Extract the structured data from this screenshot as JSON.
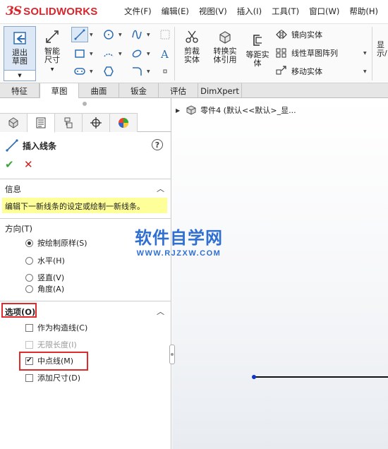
{
  "app": {
    "logo_prefix": "3S",
    "logo_name": "SOLIDWORKS"
  },
  "menubar": [
    {
      "label": "文件(F)"
    },
    {
      "label": "编辑(E)"
    },
    {
      "label": "视图(V)"
    },
    {
      "label": "插入(I)"
    },
    {
      "label": "工具(T)"
    },
    {
      "label": "窗口(W)"
    },
    {
      "label": "帮助(H)"
    }
  ],
  "ribbon": {
    "exit_sketch": "退出草图",
    "smart_dimension": "智能尺寸",
    "trim": "剪裁实体",
    "convert": "转换实体引用",
    "offset": "等距实体",
    "mirror": "镜向实体",
    "linear_pattern": "线性草图阵列",
    "move": "移动实体",
    "display_partial": "显示/"
  },
  "tabs": [
    {
      "label": "特征"
    },
    {
      "label": "草图"
    },
    {
      "label": "曲面"
    },
    {
      "label": "钣金"
    },
    {
      "label": "评估"
    },
    {
      "label": "DimXpert"
    }
  ],
  "property_manager": {
    "title": "插入线条",
    "help_symbol": "?",
    "ok_symbol": "✔",
    "cancel_symbol": "✕",
    "info_header": "信息",
    "info_text": "编辑下一新线条的设定或绘制一新线条。",
    "direction_header": "方向(T)",
    "direction_options": [
      {
        "label": "按绘制原样(S)",
        "selected": true
      },
      {
        "label": "水平(H)",
        "selected": false
      },
      {
        "label": "竖直(V)",
        "selected": false
      },
      {
        "label": "角度(A)",
        "selected": false
      }
    ],
    "options_header": "选项(O)",
    "options": [
      {
        "label": "作为构造线(C)",
        "checked": false,
        "enabled": true
      },
      {
        "label": "无限长度(I)",
        "checked": false,
        "enabled": false
      },
      {
        "label": "中点线(M)",
        "checked": true,
        "enabled": true
      },
      {
        "label": "添加尺寸(D)",
        "checked": false,
        "enabled": true
      }
    ],
    "collapse_symbol": "︿"
  },
  "graphics": {
    "tree_item": "零件4  (默认<<默认>_显...",
    "watermark_cn": "软件自学网",
    "watermark_en": "WWW.RJZXW.COM"
  },
  "colors": {
    "brand_red": "#d9252b",
    "highlight_red": "#e02b2b",
    "info_yellow": "#ffff99",
    "watermark_blue": "#2f6fd1",
    "ok_green": "#3aa63a"
  }
}
